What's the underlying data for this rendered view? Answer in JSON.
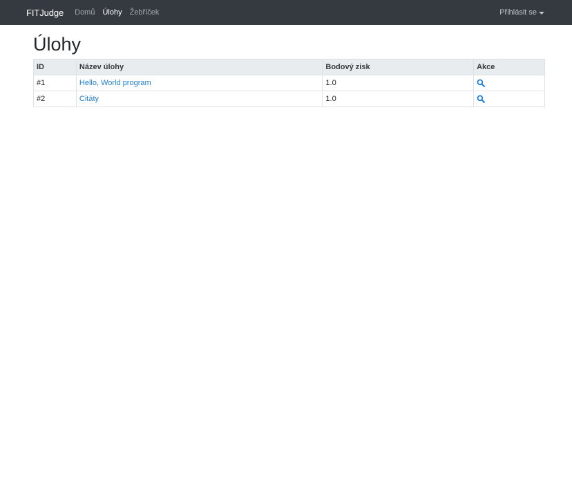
{
  "navbar": {
    "brand": "FITJudge",
    "links": [
      {
        "label": "Domů",
        "active": false
      },
      {
        "label": "Úlohy",
        "active": true
      },
      {
        "label": "Žebříček",
        "active": false
      }
    ],
    "login_label": "Přihlásit se"
  },
  "page": {
    "title": "Úlohy"
  },
  "table": {
    "headers": [
      "ID",
      "Název úlohy",
      "Bodový zisk",
      "Akce"
    ],
    "rows": [
      {
        "id": "#1",
        "name": "Hello, World program",
        "points": "1.0",
        "action_icon": "search-icon"
      },
      {
        "id": "#2",
        "name": "Citáty",
        "points": "1.0",
        "action_icon": "search-icon"
      }
    ]
  },
  "colors": {
    "navbar_bg": "#343a40",
    "link": "#1f7fd6",
    "header_bg": "#e9ecef"
  }
}
